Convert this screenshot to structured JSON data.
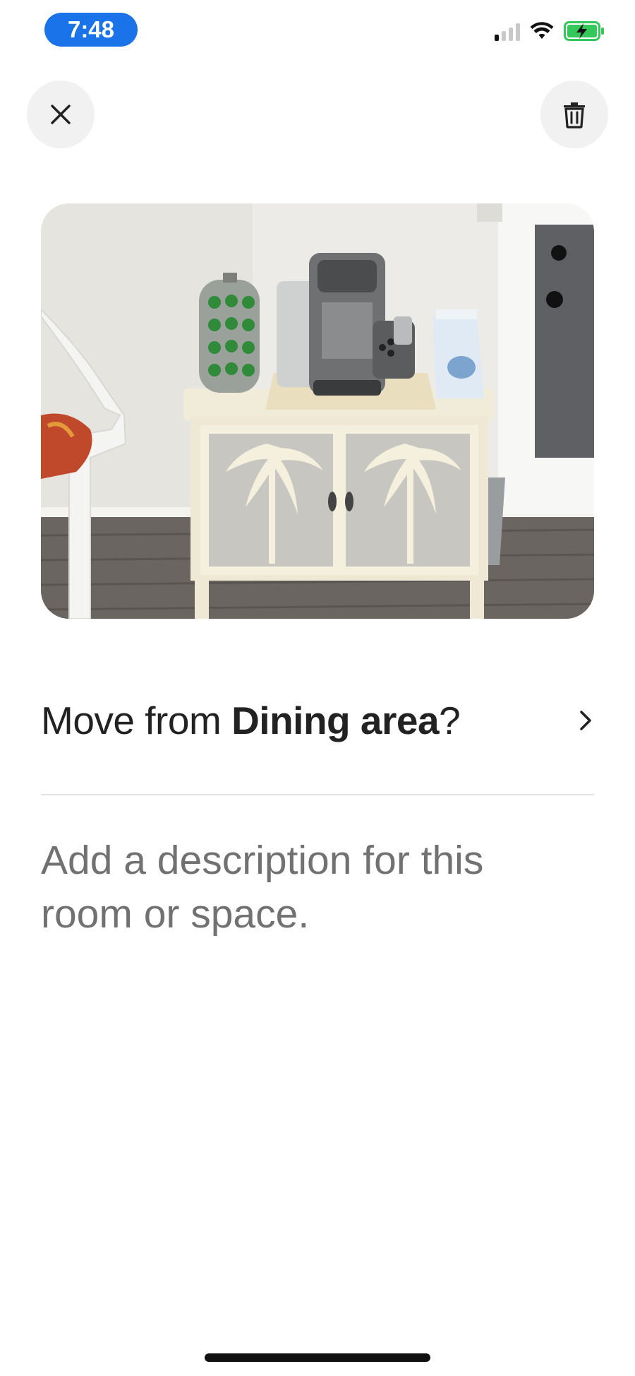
{
  "status_bar": {
    "time": "7:48",
    "icons": [
      "cellular-signal-icon",
      "wifi-icon",
      "battery-charging-icon"
    ],
    "accent": "#1a73e8",
    "battery_color": "#34c759"
  },
  "header": {
    "close_icon": "close-icon",
    "delete_icon": "trash-icon"
  },
  "photo": {
    "subject": "coffee station photo"
  },
  "move": {
    "prefix": "Move from ",
    "room": "Dining area",
    "suffix": "?",
    "chevron": "chevron-right-icon"
  },
  "description": {
    "placeholder": "Add a description for this room or space."
  }
}
